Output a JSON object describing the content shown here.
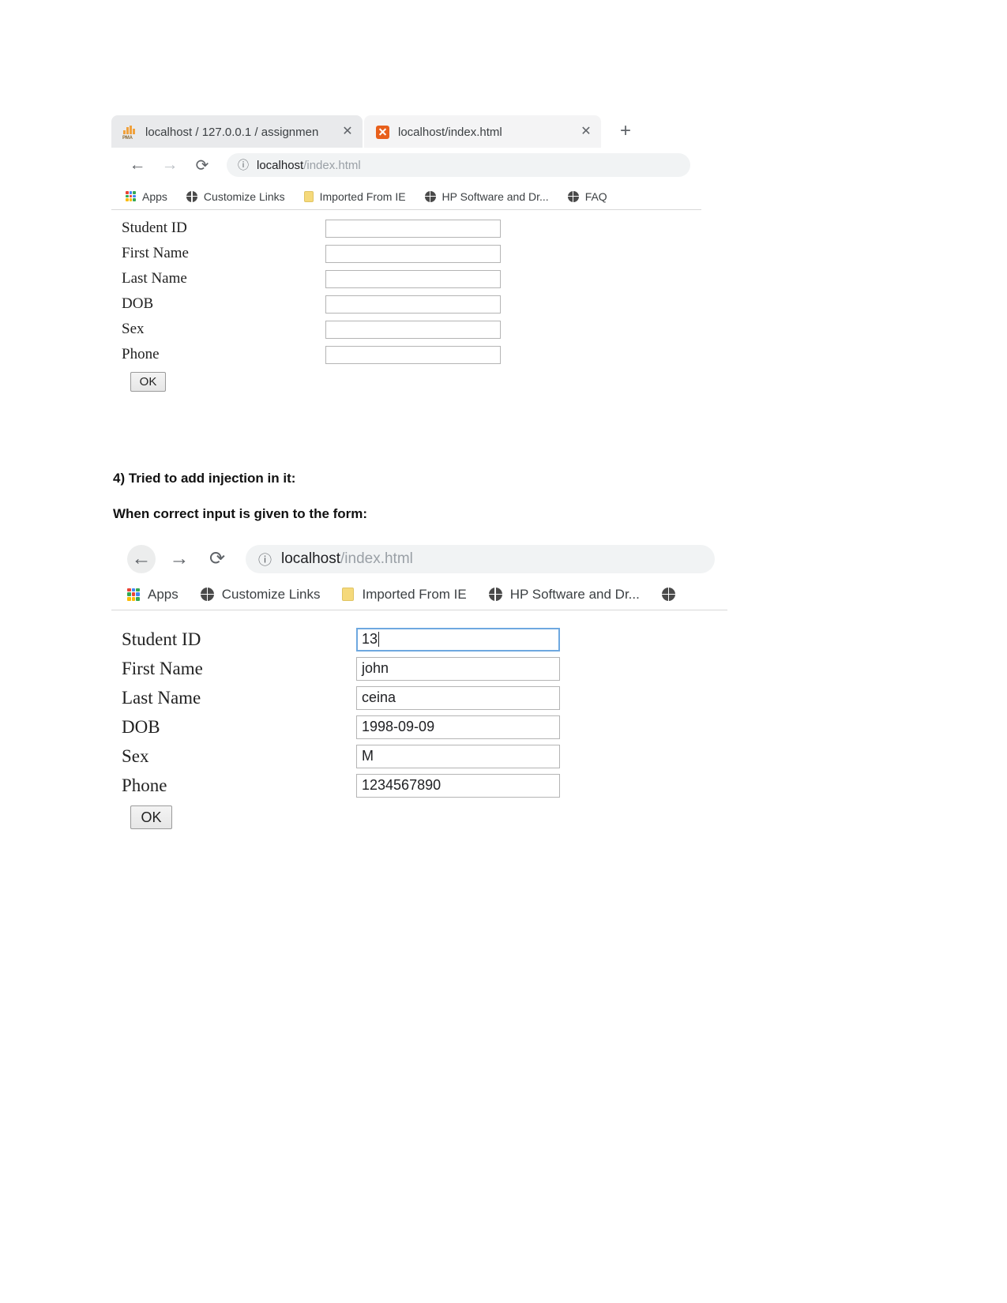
{
  "document": {
    "headings": [
      {
        "text": "4) Tried to add injection in it:"
      },
      {
        "text": "When correct input is given to the form:"
      }
    ]
  },
  "screenshot_one": {
    "tabs": [
      {
        "title": "localhost / 127.0.0.1 / assignmen",
        "favicon": "phpmyadmin-icon",
        "close_label": "✕",
        "active": false
      },
      {
        "title": "localhost/index.html",
        "favicon": "xampp-icon",
        "close_label": "✕",
        "active": true
      }
    ],
    "new_tab_label": "+",
    "nav": {
      "back_label": "←",
      "forward_label": "→",
      "reload_label": "⟳",
      "info_label": "ⓘ",
      "url_host": "localhost",
      "url_path": "/index.html"
    },
    "bookmarks": [
      {
        "label": "Apps",
        "icon": "apps-grid-icon"
      },
      {
        "label": "Customize Links",
        "icon": "globe-icon"
      },
      {
        "label": "Imported From IE",
        "icon": "folder-icon"
      },
      {
        "label": "HP Software and Dr...",
        "icon": "globe-icon"
      },
      {
        "label": "FAQ",
        "icon": "globe-icon"
      }
    ],
    "form": {
      "fields": [
        {
          "label": "Student ID",
          "value": "",
          "focused": false
        },
        {
          "label": "First Name",
          "value": "",
          "focused": false
        },
        {
          "label": "Last Name",
          "value": "",
          "focused": false
        },
        {
          "label": "DOB",
          "value": "",
          "focused": false
        },
        {
          "label": "Sex",
          "value": "",
          "focused": false
        },
        {
          "label": "Phone",
          "value": "",
          "focused": false
        }
      ],
      "submit_label": "OK"
    }
  },
  "screenshot_two": {
    "nav": {
      "back_label": "←",
      "forward_label": "→",
      "reload_label": "⟳",
      "info_label": "ⓘ",
      "url_host": "localhost",
      "url_path": "/index.html"
    },
    "bookmarks": [
      {
        "label": "Apps",
        "icon": "apps-grid-icon"
      },
      {
        "label": "Customize Links",
        "icon": "globe-icon"
      },
      {
        "label": "Imported From IE",
        "icon": "folder-icon"
      },
      {
        "label": "HP Software and Dr...",
        "icon": "globe-icon"
      },
      {
        "label": "",
        "icon": "globe-icon"
      }
    ],
    "form": {
      "fields": [
        {
          "label": "Student ID",
          "value": "13",
          "focused": true
        },
        {
          "label": "First Name",
          "value": "john",
          "focused": false
        },
        {
          "label": "Last Name",
          "value": "ceina",
          "focused": false
        },
        {
          "label": "DOB",
          "value": "1998-09-09",
          "focused": false
        },
        {
          "label": "Sex",
          "value": "M",
          "focused": false
        },
        {
          "label": "Phone",
          "value": "1234567890",
          "focused": false
        }
      ],
      "submit_label": "OK"
    }
  },
  "colors": {
    "tab_inactive": "#e9eaec",
    "tab_active": "#f4f4f5",
    "omnibox": "#f1f3f4",
    "focus_border": "#6ea8e0",
    "xampp_orange": "#e8601c",
    "folder_yellow": "#f5d97b",
    "text_primary": "#202124",
    "text_dim": "#9aa0a6"
  }
}
